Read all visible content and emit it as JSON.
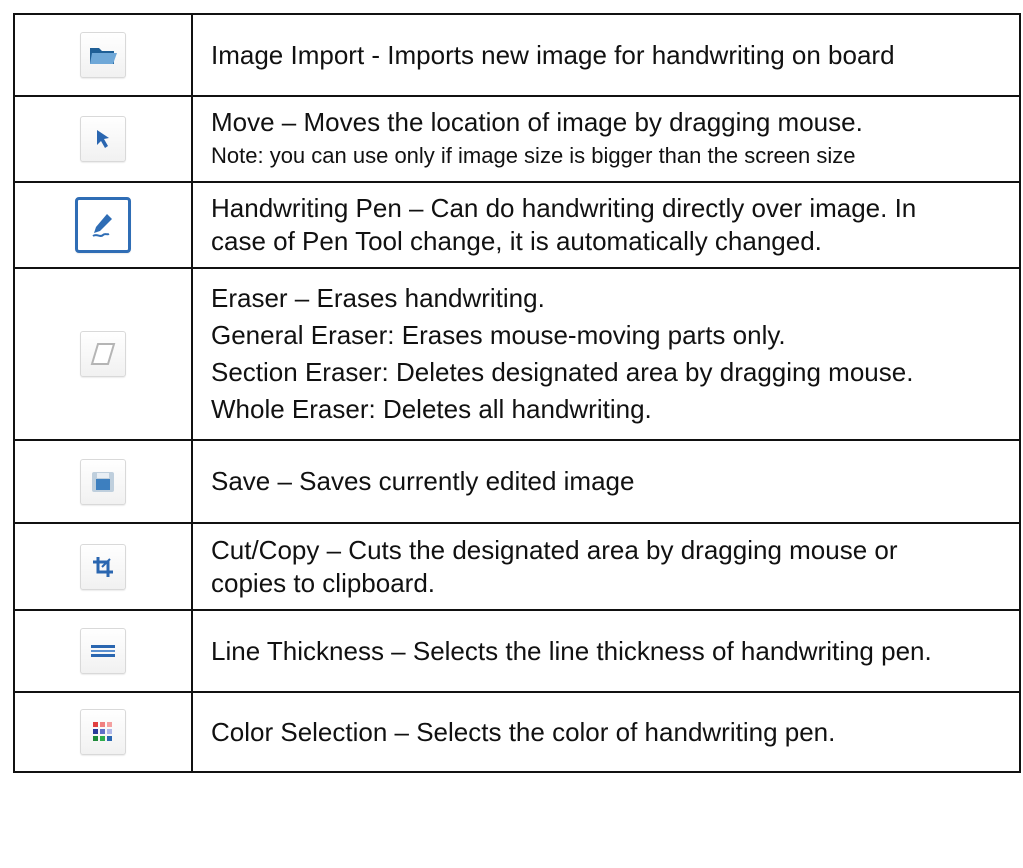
{
  "rows": [
    {
      "icon": "folder-open-icon",
      "lines": [
        "Image Import - Imports new image for handwriting on board"
      ]
    },
    {
      "icon": "move-cursor-icon",
      "lines": [
        "Move – Moves the location of image by dragging mouse."
      ],
      "note": "Note: you can use only if image size is bigger than the screen size"
    },
    {
      "icon": "pen-icon",
      "lines": [
        "Handwriting Pen – Can do handwriting directly over image. In",
        "case of Pen Tool change, it is automatically changed."
      ]
    },
    {
      "icon": "eraser-icon",
      "lines": [
        "Eraser – Erases handwriting.",
        "General Eraser: Erases mouse-moving parts only.",
        "Section Eraser: Deletes designated area by dragging mouse.",
        "Whole Eraser: Deletes all handwriting."
      ]
    },
    {
      "icon": "save-icon",
      "lines": [
        "Save – Saves currently edited image"
      ]
    },
    {
      "icon": "crop-icon",
      "lines": [
        "Cut/Copy – Cuts the designated area by dragging mouse or",
        "copies to clipboard."
      ]
    },
    {
      "icon": "line-thickness-icon",
      "lines": [
        "Line Thickness – Selects the line thickness of handwriting pen."
      ]
    },
    {
      "icon": "color-palette-icon",
      "lines": [
        "Color Selection – Selects the color of handwriting pen."
      ]
    }
  ],
  "colors": {
    "accent": "#2f6db5",
    "border": "#111111"
  }
}
